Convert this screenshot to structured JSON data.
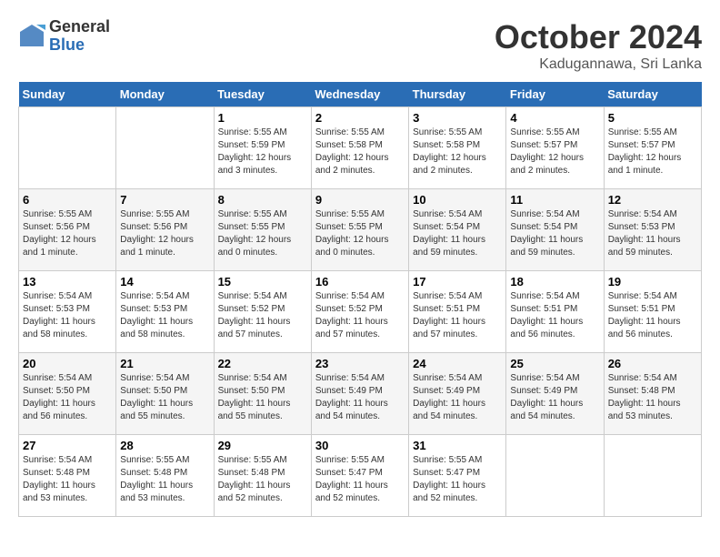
{
  "logo": {
    "general": "General",
    "blue": "Blue"
  },
  "title": "October 2024",
  "location": "Kadugannawa, Sri Lanka",
  "days_header": [
    "Sunday",
    "Monday",
    "Tuesday",
    "Wednesday",
    "Thursday",
    "Friday",
    "Saturday"
  ],
  "weeks": [
    [
      {
        "day": "",
        "sunrise": "",
        "sunset": "",
        "daylight": ""
      },
      {
        "day": "",
        "sunrise": "",
        "sunset": "",
        "daylight": ""
      },
      {
        "day": "1",
        "sunrise": "Sunrise: 5:55 AM",
        "sunset": "Sunset: 5:59 PM",
        "daylight": "Daylight: 12 hours and 3 minutes."
      },
      {
        "day": "2",
        "sunrise": "Sunrise: 5:55 AM",
        "sunset": "Sunset: 5:58 PM",
        "daylight": "Daylight: 12 hours and 2 minutes."
      },
      {
        "day": "3",
        "sunrise": "Sunrise: 5:55 AM",
        "sunset": "Sunset: 5:58 PM",
        "daylight": "Daylight: 12 hours and 2 minutes."
      },
      {
        "day": "4",
        "sunrise": "Sunrise: 5:55 AM",
        "sunset": "Sunset: 5:57 PM",
        "daylight": "Daylight: 12 hours and 2 minutes."
      },
      {
        "day": "5",
        "sunrise": "Sunrise: 5:55 AM",
        "sunset": "Sunset: 5:57 PM",
        "daylight": "Daylight: 12 hours and 1 minute."
      }
    ],
    [
      {
        "day": "6",
        "sunrise": "Sunrise: 5:55 AM",
        "sunset": "Sunset: 5:56 PM",
        "daylight": "Daylight: 12 hours and 1 minute."
      },
      {
        "day": "7",
        "sunrise": "Sunrise: 5:55 AM",
        "sunset": "Sunset: 5:56 PM",
        "daylight": "Daylight: 12 hours and 1 minute."
      },
      {
        "day": "8",
        "sunrise": "Sunrise: 5:55 AM",
        "sunset": "Sunset: 5:55 PM",
        "daylight": "Daylight: 12 hours and 0 minutes."
      },
      {
        "day": "9",
        "sunrise": "Sunrise: 5:55 AM",
        "sunset": "Sunset: 5:55 PM",
        "daylight": "Daylight: 12 hours and 0 minutes."
      },
      {
        "day": "10",
        "sunrise": "Sunrise: 5:54 AM",
        "sunset": "Sunset: 5:54 PM",
        "daylight": "Daylight: 11 hours and 59 minutes."
      },
      {
        "day": "11",
        "sunrise": "Sunrise: 5:54 AM",
        "sunset": "Sunset: 5:54 PM",
        "daylight": "Daylight: 11 hours and 59 minutes."
      },
      {
        "day": "12",
        "sunrise": "Sunrise: 5:54 AM",
        "sunset": "Sunset: 5:53 PM",
        "daylight": "Daylight: 11 hours and 59 minutes."
      }
    ],
    [
      {
        "day": "13",
        "sunrise": "Sunrise: 5:54 AM",
        "sunset": "Sunset: 5:53 PM",
        "daylight": "Daylight: 11 hours and 58 minutes."
      },
      {
        "day": "14",
        "sunrise": "Sunrise: 5:54 AM",
        "sunset": "Sunset: 5:53 PM",
        "daylight": "Daylight: 11 hours and 58 minutes."
      },
      {
        "day": "15",
        "sunrise": "Sunrise: 5:54 AM",
        "sunset": "Sunset: 5:52 PM",
        "daylight": "Daylight: 11 hours and 57 minutes."
      },
      {
        "day": "16",
        "sunrise": "Sunrise: 5:54 AM",
        "sunset": "Sunset: 5:52 PM",
        "daylight": "Daylight: 11 hours and 57 minutes."
      },
      {
        "day": "17",
        "sunrise": "Sunrise: 5:54 AM",
        "sunset": "Sunset: 5:51 PM",
        "daylight": "Daylight: 11 hours and 57 minutes."
      },
      {
        "day": "18",
        "sunrise": "Sunrise: 5:54 AM",
        "sunset": "Sunset: 5:51 PM",
        "daylight": "Daylight: 11 hours and 56 minutes."
      },
      {
        "day": "19",
        "sunrise": "Sunrise: 5:54 AM",
        "sunset": "Sunset: 5:51 PM",
        "daylight": "Daylight: 11 hours and 56 minutes."
      }
    ],
    [
      {
        "day": "20",
        "sunrise": "Sunrise: 5:54 AM",
        "sunset": "Sunset: 5:50 PM",
        "daylight": "Daylight: 11 hours and 56 minutes."
      },
      {
        "day": "21",
        "sunrise": "Sunrise: 5:54 AM",
        "sunset": "Sunset: 5:50 PM",
        "daylight": "Daylight: 11 hours and 55 minutes."
      },
      {
        "day": "22",
        "sunrise": "Sunrise: 5:54 AM",
        "sunset": "Sunset: 5:50 PM",
        "daylight": "Daylight: 11 hours and 55 minutes."
      },
      {
        "day": "23",
        "sunrise": "Sunrise: 5:54 AM",
        "sunset": "Sunset: 5:49 PM",
        "daylight": "Daylight: 11 hours and 54 minutes."
      },
      {
        "day": "24",
        "sunrise": "Sunrise: 5:54 AM",
        "sunset": "Sunset: 5:49 PM",
        "daylight": "Daylight: 11 hours and 54 minutes."
      },
      {
        "day": "25",
        "sunrise": "Sunrise: 5:54 AM",
        "sunset": "Sunset: 5:49 PM",
        "daylight": "Daylight: 11 hours and 54 minutes."
      },
      {
        "day": "26",
        "sunrise": "Sunrise: 5:54 AM",
        "sunset": "Sunset: 5:48 PM",
        "daylight": "Daylight: 11 hours and 53 minutes."
      }
    ],
    [
      {
        "day": "27",
        "sunrise": "Sunrise: 5:54 AM",
        "sunset": "Sunset: 5:48 PM",
        "daylight": "Daylight: 11 hours and 53 minutes."
      },
      {
        "day": "28",
        "sunrise": "Sunrise: 5:55 AM",
        "sunset": "Sunset: 5:48 PM",
        "daylight": "Daylight: 11 hours and 53 minutes."
      },
      {
        "day": "29",
        "sunrise": "Sunrise: 5:55 AM",
        "sunset": "Sunset: 5:48 PM",
        "daylight": "Daylight: 11 hours and 52 minutes."
      },
      {
        "day": "30",
        "sunrise": "Sunrise: 5:55 AM",
        "sunset": "Sunset: 5:47 PM",
        "daylight": "Daylight: 11 hours and 52 minutes."
      },
      {
        "day": "31",
        "sunrise": "Sunrise: 5:55 AM",
        "sunset": "Sunset: 5:47 PM",
        "daylight": "Daylight: 11 hours and 52 minutes."
      },
      {
        "day": "",
        "sunrise": "",
        "sunset": "",
        "daylight": ""
      },
      {
        "day": "",
        "sunrise": "",
        "sunset": "",
        "daylight": ""
      }
    ]
  ]
}
